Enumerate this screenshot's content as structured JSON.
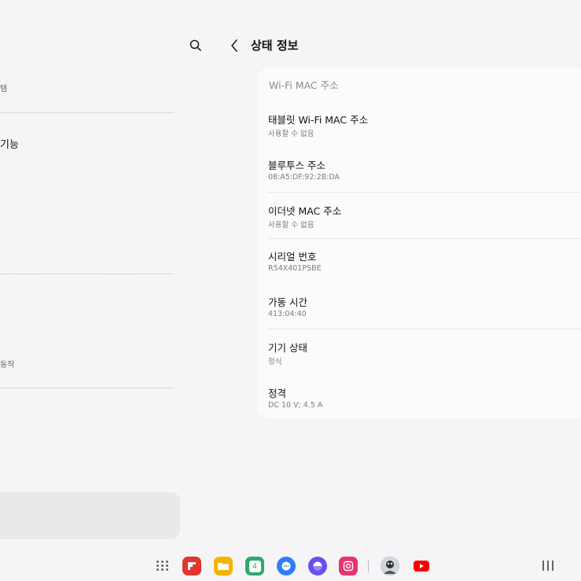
{
  "left_pane": {
    "label_1": "템",
    "item_1": "기능",
    "label_2": "동작"
  },
  "header": {
    "title": "상태 정보"
  },
  "card": {
    "header": "Wi-Fi MAC 주소",
    "rows": [
      {
        "title": "태블릿 Wi-Fi MAC 주소",
        "value": "사용할 수 없음"
      },
      {
        "title": "블루투스 주소",
        "value": "08:A5:DF:92:2B:DA"
      },
      {
        "title": "이더넷 MAC 주소",
        "value": "사용할 수 없음"
      },
      {
        "title": "시리얼 번호",
        "value": "R54X401PSBE"
      },
      {
        "title": "가동 시간",
        "value": "413:04:40"
      },
      {
        "title": "기기 상태",
        "value": "정식"
      },
      {
        "title": "정격",
        "value": "DC 10 V; 4.5 A"
      }
    ]
  },
  "taskbar": {
    "apps": [
      {
        "name": "flipboard-icon",
        "color": "#e0362c"
      },
      {
        "name": "my-files-icon",
        "color": "#f5b400"
      },
      {
        "name": "calendar-icon",
        "color": "#2fa86b",
        "badge": "4"
      },
      {
        "name": "messages-icon",
        "color": "#2f7cf6"
      },
      {
        "name": "internet-icon",
        "color": "#6a4ff0"
      },
      {
        "name": "camera-icon",
        "color": "#e8336e"
      },
      {
        "name": "avatar-app-icon",
        "color": "#7f8a94"
      },
      {
        "name": "youtube-icon",
        "color": "#ff0000"
      }
    ]
  }
}
